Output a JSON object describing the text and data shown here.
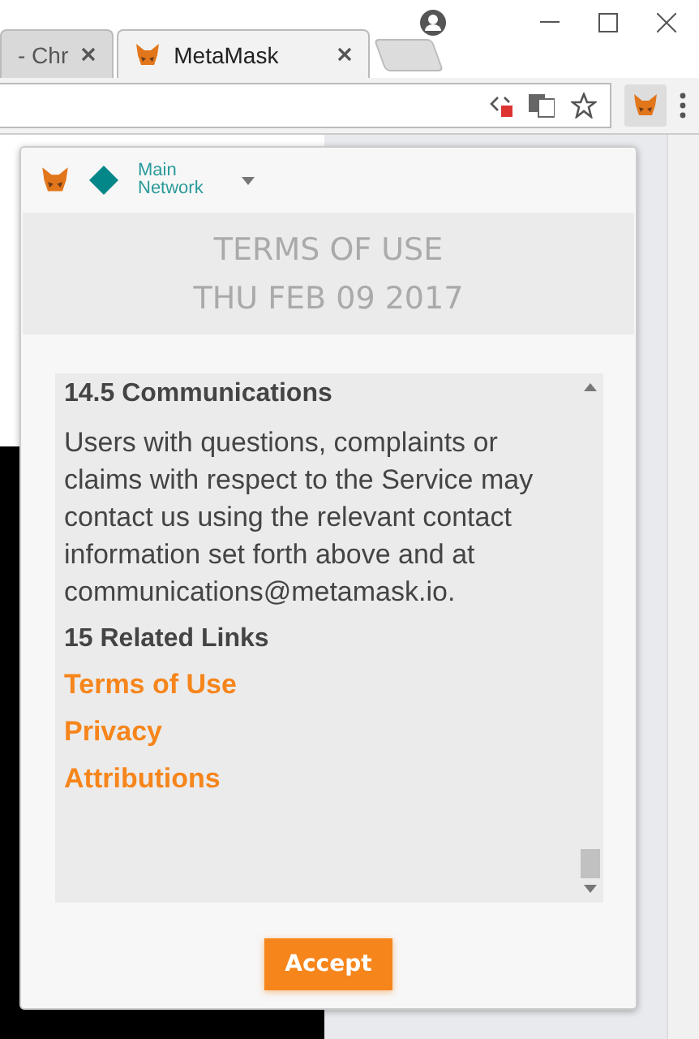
{
  "browser": {
    "tabs": [
      {
        "title": "- Chr",
        "selected": false
      },
      {
        "title": "MetaMask",
        "selected": true
      }
    ]
  },
  "popup": {
    "network": "Main Network",
    "title": "TERMS OF USE",
    "date": "THU FEB 09 2017",
    "sections": [
      {
        "kind": "heading",
        "text": "14.5 Communications"
      },
      {
        "kind": "paragraph",
        "text": "Users with questions, complaints or claims with respect to the Service may contact us using the relevant contact information set forth above and at communications@metamask.io."
      },
      {
        "kind": "heading",
        "text": "15 Related Links"
      },
      {
        "kind": "link",
        "text": "Terms of Use"
      },
      {
        "kind": "link",
        "text": "Privacy"
      },
      {
        "kind": "link",
        "text": "Attributions"
      }
    ],
    "accept_button": "Accept"
  }
}
